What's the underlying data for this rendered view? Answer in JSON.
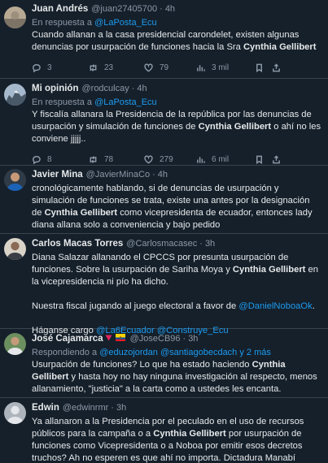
{
  "tweets": [
    {
      "name": "Juan Andrés",
      "handle": "@juan27405700",
      "time": "4h",
      "reply_prefix": "En respuesta a",
      "reply_to": "@LaPosta_Ecu",
      "text_1": "Cuando allanan a la casa presidencial carondelet, existen algunas denuncias por usurpación de funciones hacia la Sra ",
      "text_bold": "Cynthia Gellibert",
      "replies": "3",
      "retweets": "23",
      "likes": "79",
      "views": "3 mil"
    },
    {
      "name": "Mi opinión",
      "handle": "@rodculcay",
      "time": "4h",
      "reply_prefix": "En respuesta a",
      "reply_to": "@LaPosta_Ecu",
      "text_1": "Y fiscalía allanara la Presidencia de la república por las denuncias de usurpación y simulación de funciones  de ",
      "text_bold": "Cynthia Gellibert",
      "text_2": " o ahí no les conviene jjjjj..",
      "replies": "8",
      "retweets": "78",
      "likes": "279",
      "views": "6 mil"
    },
    {
      "name": "Javier Mina",
      "handle": "@JavierMinaCo",
      "time": "4h",
      "text_1": "cronológicamente hablando, si de denuncias de usurpación y simulación de funciones se trata, existe una antes por la designación de ",
      "text_bold": "Cynthia Gellibert",
      "text_2": " como vicepresidenta de ecuador, entonces lady diana allana solo a conveniencia y bajo pedido"
    },
    {
      "name": "Carlos Macas Torres",
      "handle": "@Carlosmacasec",
      "time": "3h",
      "text_1": "Diana Salazar allanando el CPCCS por presunta usurpación de funciones. Sobre la usurpación de Sariha Moya y ",
      "text_bold": "Cynthia Gellibert",
      "text_2": " en la vicepresidencia ni pío ha dicho.",
      "text_3": "Nuestra fiscal jugando al juego electoral a favor de ",
      "mention_1": "@DanielNoboaOk",
      "text_4": ".",
      "text_5": "Háganse cargo ",
      "mention_2": "@La6Ecuador",
      "mention_3": "@Construye_Ecu"
    },
    {
      "name": "José Cajamarca",
      "handle": "@JoseCB96",
      "time": "3h",
      "reply_prefix": "Respondiendo a",
      "reply_to": "@eduzojordan @santiagobecdach y 2 más",
      "text_1": "Usurpación de funciones? Lo que ha estado haciendo ",
      "text_bold": "Cynthia Gellibert",
      "text_2": " y hasta hoy no hay ninguna investigación al respecto, menos allanamiento, \"justicia\" a la carta como a ustedes les encanta."
    },
    {
      "name": "Edwin",
      "handle": "@edwinrmr",
      "time": "3h",
      "text_1": "Ya allanaron a la Presidencia por el peculado en el uso de recursos públicos para la campaña o a ",
      "text_bold": "Cynthia Gellibert",
      "text_2": " por usurpación de funciones como Vicepresidenta o a Noboa por emitir esos decretos truchos? Ah no esperen es que ahí no importa. Dictadura Manabí Fiscalía CPCCS"
    }
  ],
  "colors": {
    "background": "#15202b",
    "text": "#e7e9ea",
    "muted": "#8b98a5",
    "link": "#1d9bf0",
    "divider": "#38444d"
  },
  "icons": [
    "reply-icon",
    "retweet-icon",
    "like-icon",
    "views-icon",
    "bookmark-icon",
    "share-icon"
  ]
}
